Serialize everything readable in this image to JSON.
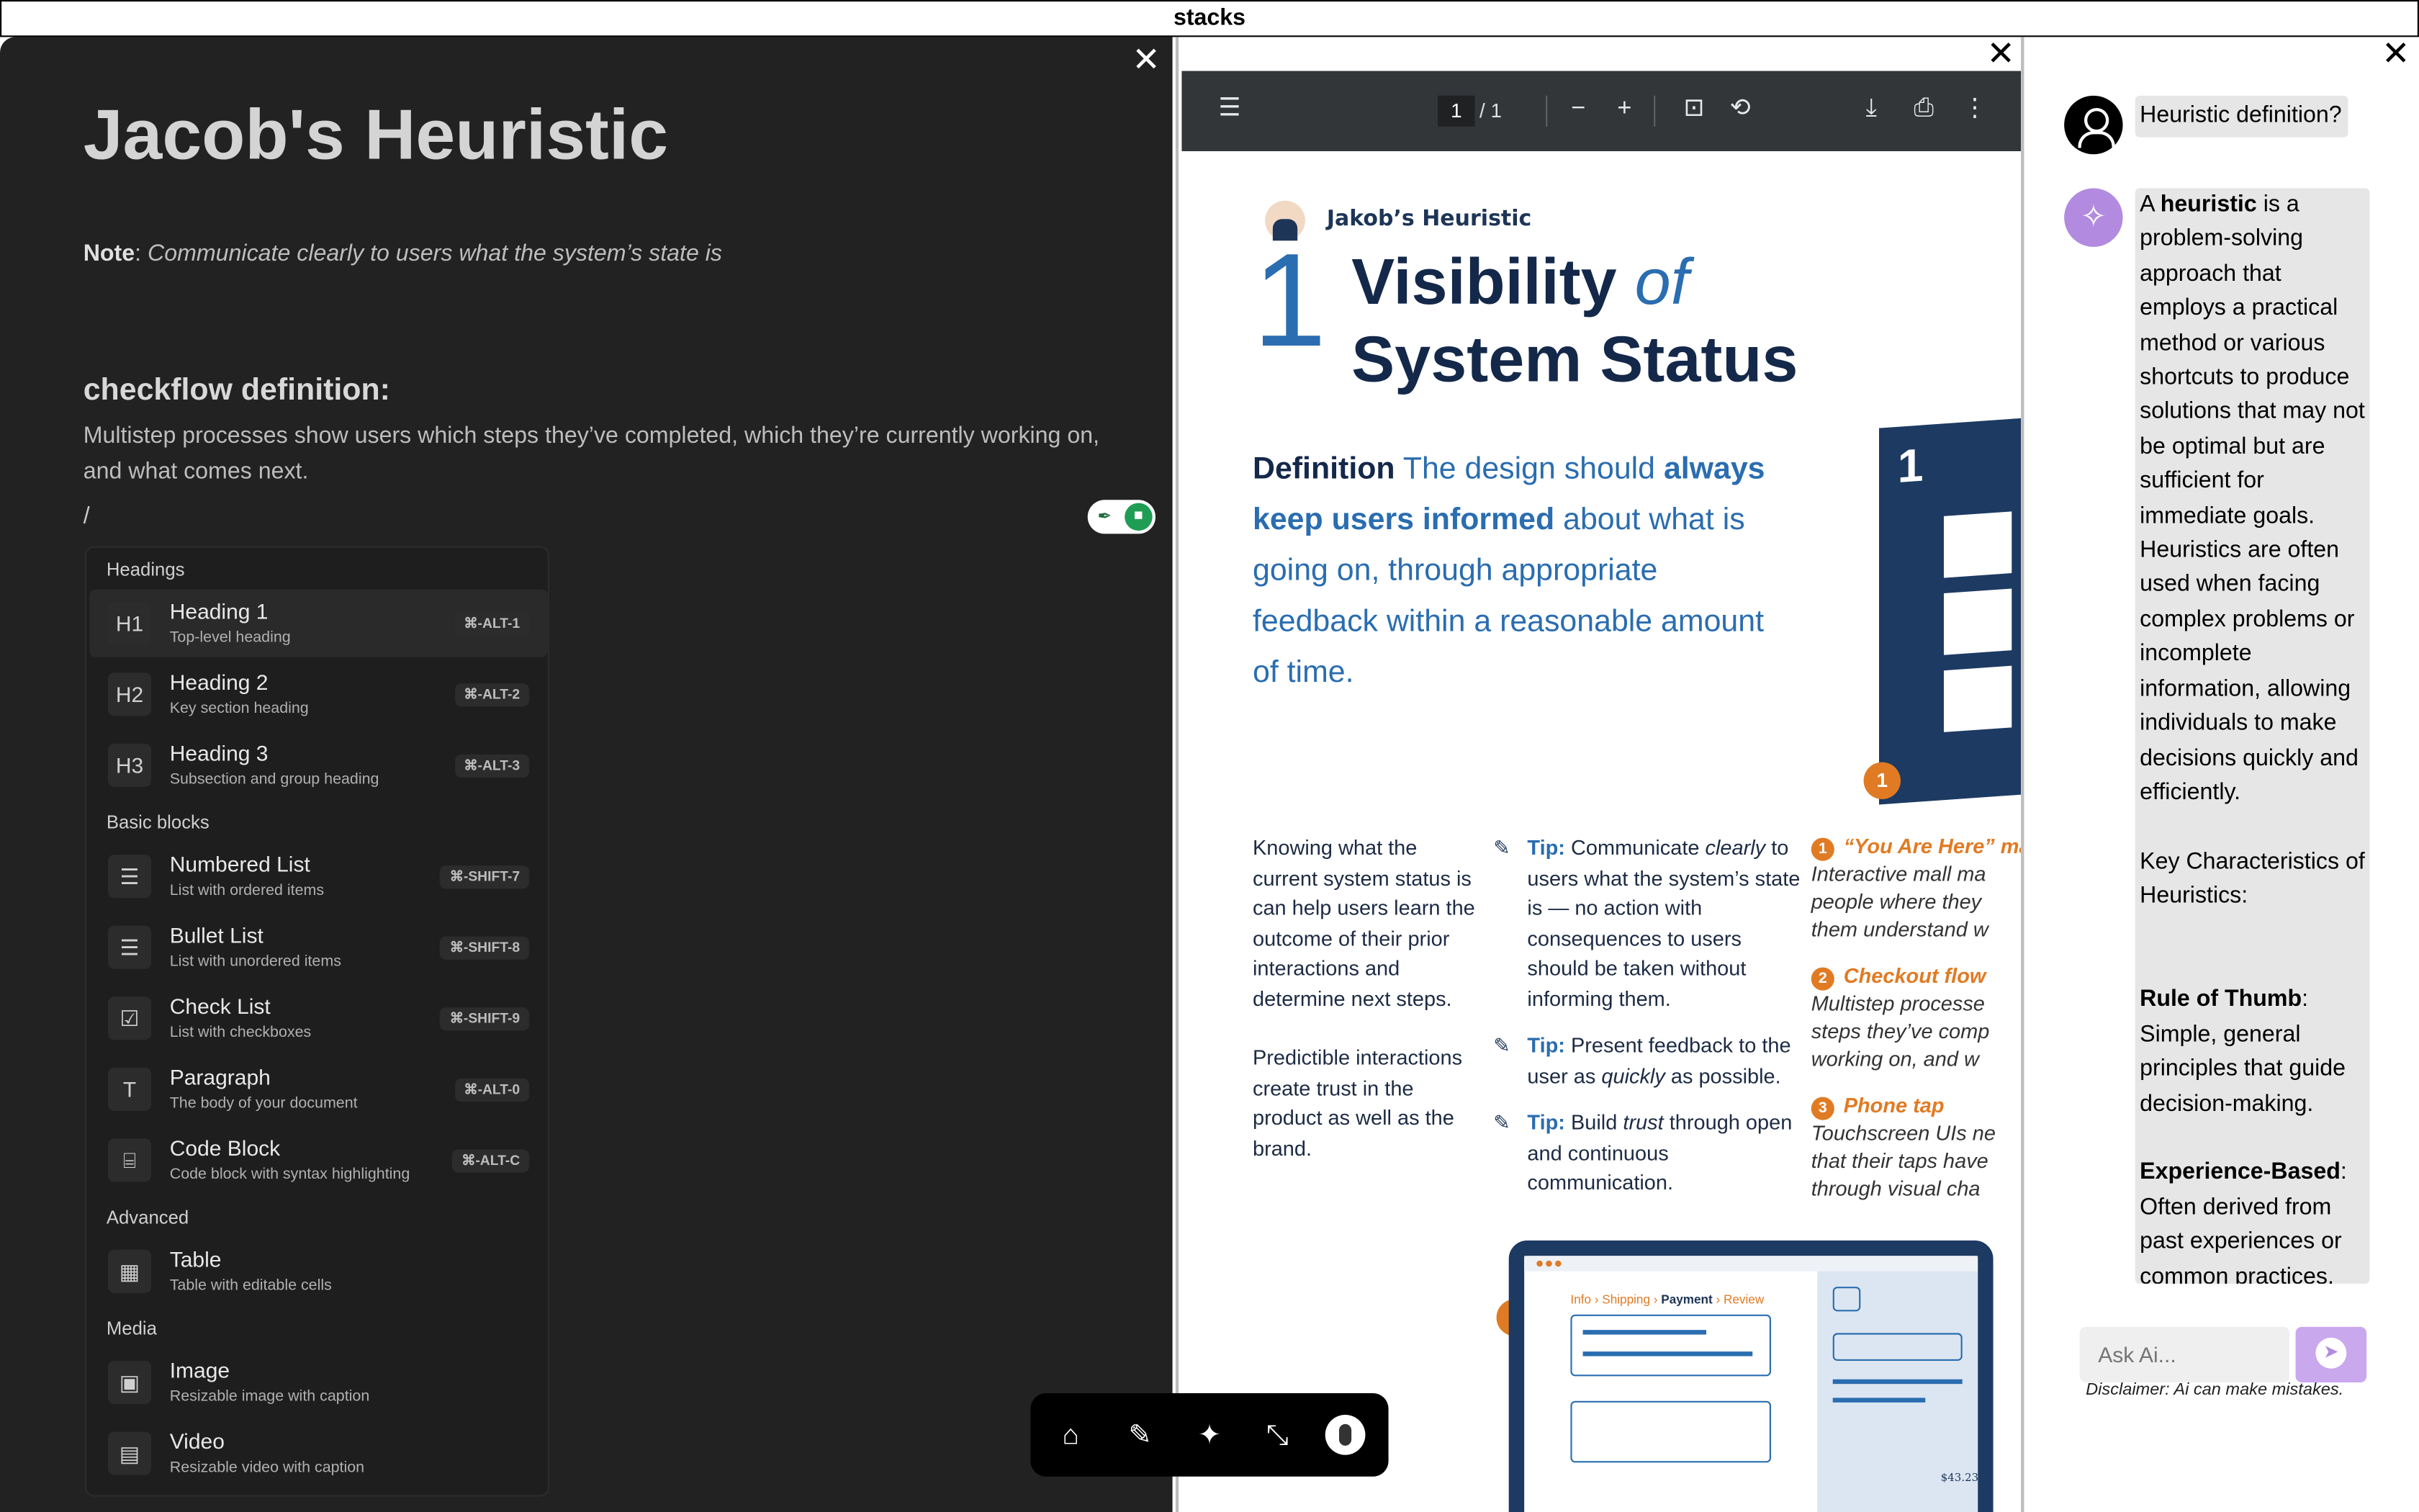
{
  "app": {
    "title": "stacks"
  },
  "editor": {
    "close_label": "✕",
    "doc_title": "Jacob's Heuristic",
    "note_label": "Note",
    "note_text": "Communicate clearly to users what the system’s state is",
    "subheading": "checkflow definition:",
    "paragraph": "Multistep processes show users which steps they’ve completed, which they’re currently working on, and what comes next.",
    "slash_input": "/",
    "slash_menu": {
      "sections": {
        "headings": "Headings",
        "basic": "Basic blocks",
        "advanced": "Advanced",
        "media": "Media"
      },
      "items": [
        {
          "icon": "H1",
          "label": "Heading 1",
          "sub": "Top-level heading",
          "shortcut": "⌘-ALT-1"
        },
        {
          "icon": "H2",
          "label": "Heading 2",
          "sub": "Key section heading",
          "shortcut": "⌘-ALT-2"
        },
        {
          "icon": "H3",
          "label": "Heading 3",
          "sub": "Subsection and group heading",
          "shortcut": "⌘-ALT-3"
        },
        {
          "icon": "☰",
          "label": "Numbered List",
          "sub": "List with ordered items",
          "shortcut": "⌘-SHIFT-7"
        },
        {
          "icon": "☰",
          "label": "Bullet List",
          "sub": "List with unordered items",
          "shortcut": "⌘-SHIFT-8"
        },
        {
          "icon": "☑",
          "label": "Check List",
          "sub": "List with checkboxes",
          "shortcut": "⌘-SHIFT-9"
        },
        {
          "icon": "T",
          "label": "Paragraph",
          "sub": "The body of your document",
          "shortcut": "⌘-ALT-0"
        },
        {
          "icon": "⌸",
          "label": "Code Block",
          "sub": "Code block with syntax highlighting",
          "shortcut": "⌘-ALT-C"
        },
        {
          "icon": "▦",
          "label": "Table",
          "sub": "Table with editable cells"
        },
        {
          "icon": "▣",
          "label": "Image",
          "sub": "Resizable image with caption"
        },
        {
          "icon": "▤",
          "label": "Video",
          "sub": "Resizable video with caption"
        }
      ]
    }
  },
  "dock": {
    "home": "⌂",
    "tools": "✎",
    "ai": "✦",
    "collapse": "⤡"
  },
  "pdf": {
    "close_label": "✕",
    "toolbar": {
      "menu": "☰",
      "page_current": "1",
      "page_total": "/  1",
      "zoom_out": "−",
      "zoom_in": "+",
      "fit": "⊡",
      "rotate": "⟲",
      "download": "⤓",
      "print": "⎙",
      "more": "⋮"
    },
    "page": {
      "kicker": "Jakob’s Heuristic",
      "number": "1",
      "title_a": "Visibility",
      "title_of": "of",
      "title_b": "System Status",
      "definition_word": "Definition",
      "definition_1": "The design should",
      "definition_strong": "always keep users informed",
      "definition_2": "about what is going on, through appropriate feedback within a reasonable amount of time.",
      "illus_number": "1",
      "col1_p1": "Knowing what the current system status is can help users learn the outcome of their prior interactions and determine next steps.",
      "col1_p2": "Predictible interactions create trust in the product as well as the brand.",
      "tip_label": "Tip:",
      "tip1_a": "Communicate",
      "tip1_em": "clearly",
      "tip1_b": "to users what the system’s state is — no action with consequences to users should be taken without informing them.",
      "tip2_a": "Present feedback to the user as",
      "tip2_em": "quickly",
      "tip2_b": "as possible.",
      "tip3_a": "Build",
      "tip3_em": "trust",
      "tip3_b": "through open and continuous communication.",
      "ex1_title": "“You Are Here” ma",
      "ex1_text": "Interactive mall ma people where they them understand w",
      "ex2_title": "Checkout flow",
      "ex2_text": "Multistep processe steps they’ve comp working on, and w",
      "ex3_title": "Phone tap",
      "ex3_text": "Touchscreen UIs ne that their taps have through visual cha",
      "mock_crumb_a": "Info › Shipping ›",
      "mock_crumb_b": "Payment",
      "mock_crumb_c": "› Review",
      "mock_price": "$43.23",
      "badge2": "2"
    }
  },
  "ai": {
    "close_label": "✕",
    "user_question": "Heuristic definition?",
    "answer_intro_a": "A",
    "answer_intro_b": "heuristic",
    "answer_intro_c": "is a problem-solving approach that employs a practical method or various shortcuts to produce solutions that may not be optimal but are sufficient for immediate goals. Heuristics are often used when facing complex problems or incomplete information, allowing individuals to make decisions quickly and efficiently.",
    "answer_key": "Key Characteristics of Heuristics:",
    "rule_title": "Rule of Thumb",
    "rule_text": "Simple, general principles that guide decision-making.",
    "exp_title": "Experience-Based",
    "exp_text": "Often derived from past experiences or common practices.",
    "input_placeholder": "Ask Ai...",
    "disclaimer": "Disclaimer: Ai can make mistakes."
  },
  "colors": {
    "accent": "#2a6db0",
    "navy": "#14284a",
    "orange": "#e07b24",
    "ai_purple": "#b28be0"
  }
}
